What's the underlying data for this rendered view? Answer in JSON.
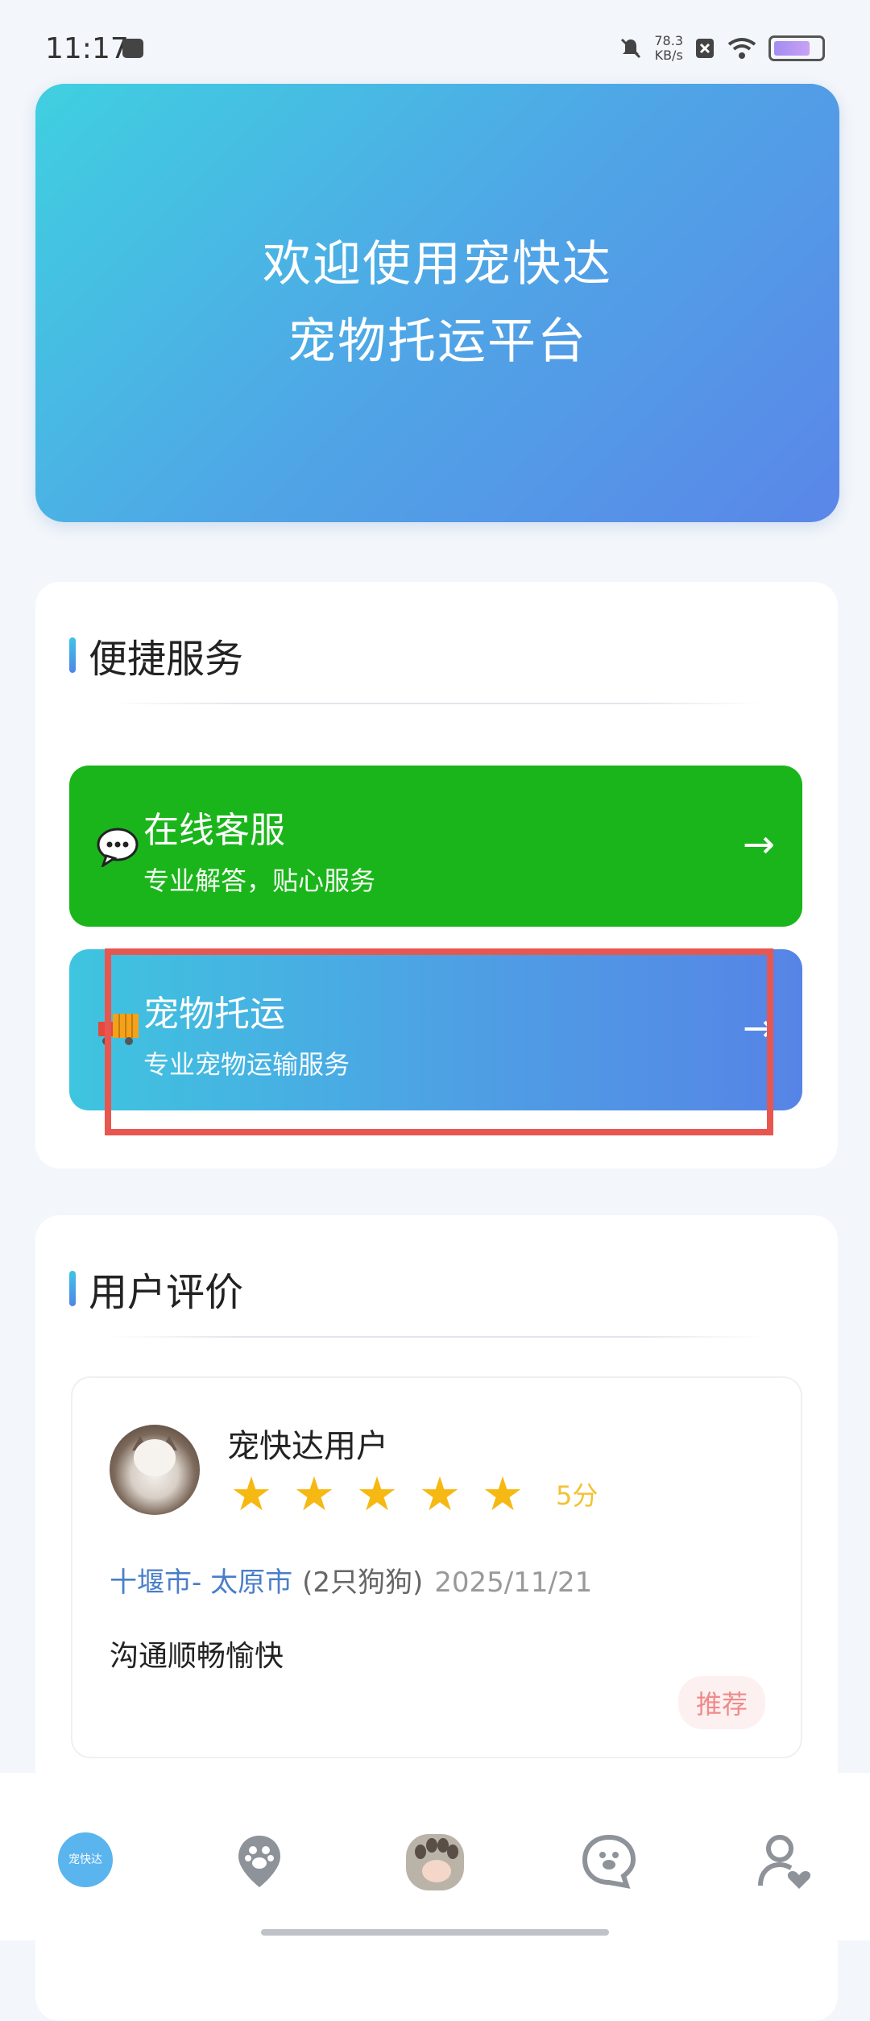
{
  "status_bar": {
    "time": "11:17",
    "speed_value": "78.3",
    "speed_unit": "KB/s"
  },
  "banner": {
    "line1": "欢迎使用宠快达",
    "line2": "宠物托运平台"
  },
  "services": {
    "title": "便捷服务",
    "items": [
      {
        "icon": "chat-bubble-icon",
        "title": "在线客服",
        "subtitle": "专业解答，贴心服务",
        "arrow": "→",
        "color": "#1ab51a"
      },
      {
        "icon": "delivery-truck-icon",
        "title": "宠物托运",
        "subtitle": "专业宠物运输服务",
        "arrow": "→",
        "color": "#4da2e4"
      }
    ]
  },
  "reviews": {
    "title": "用户评价",
    "items": [
      {
        "user": "宠快达用户",
        "stars": 5,
        "rating_text": "5分",
        "route": "十堰市- 太原市",
        "pets": "(2只狗狗)",
        "date": "2025/11/21",
        "text": "沟通顺畅愉快",
        "tag": "推荐"
      }
    ]
  },
  "tab_bar": {
    "home_logo": "宠快达",
    "items": [
      "home-logo-icon",
      "map-pin-paw-icon",
      "paw-icon",
      "chat-paw-icon",
      "user-heart-icon"
    ]
  }
}
